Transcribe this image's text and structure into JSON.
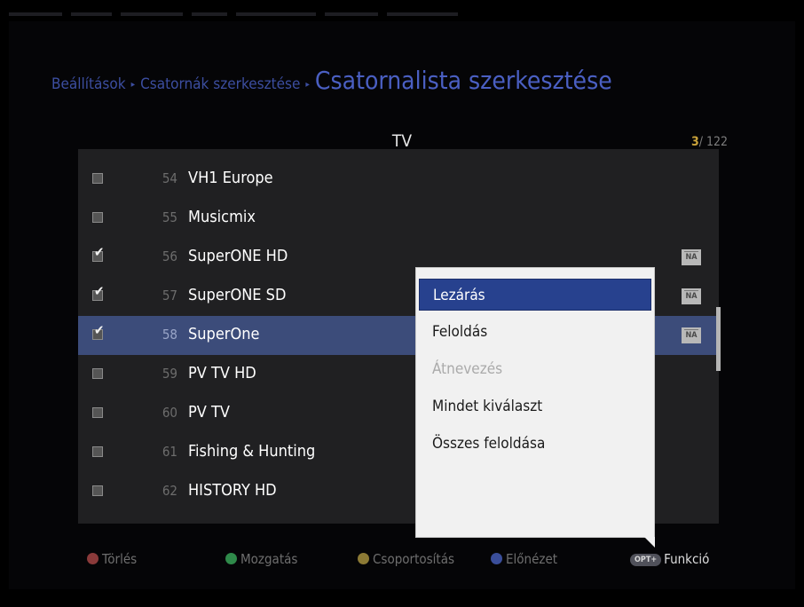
{
  "breadcrumb": {
    "items": [
      "Beállítások",
      "Csatornák szerkesztése"
    ],
    "current": "Csatornalista szerkesztése"
  },
  "list": {
    "title": "TV",
    "page_current": "3",
    "page_total": "/ 122",
    "badge_text": "NA",
    "channels": [
      {
        "num": "54",
        "name": "VH1 Europe",
        "checked": false,
        "locked": false,
        "selected": false
      },
      {
        "num": "55",
        "name": "Musicmix",
        "checked": false,
        "locked": false,
        "selected": false
      },
      {
        "num": "56",
        "name": "SuperONE HD",
        "checked": true,
        "locked": true,
        "selected": false
      },
      {
        "num": "57",
        "name": "SuperONE SD",
        "checked": true,
        "locked": true,
        "selected": false
      },
      {
        "num": "58",
        "name": "SuperOne",
        "checked": true,
        "locked": true,
        "selected": true
      },
      {
        "num": "59",
        "name": "PV TV HD",
        "checked": false,
        "locked": false,
        "selected": false
      },
      {
        "num": "60",
        "name": "PV TV",
        "checked": false,
        "locked": false,
        "selected": false
      },
      {
        "num": "61",
        "name": "Fishing & Hunting",
        "checked": false,
        "locked": false,
        "selected": false
      },
      {
        "num": "62",
        "name": "HISTORY HD",
        "checked": false,
        "locked": false,
        "selected": false
      }
    ]
  },
  "popup": {
    "items": [
      {
        "label": "Lezárás",
        "state": "active"
      },
      {
        "label": "Feloldás",
        "state": "normal"
      },
      {
        "label": "Átnevezés",
        "state": "disabled"
      },
      {
        "label": "Mindet kiválaszt",
        "state": "normal"
      },
      {
        "label": "Összes feloldása",
        "state": "normal"
      }
    ]
  },
  "footer": {
    "red": "Törlés",
    "green": "Mozgatás",
    "yellow": "Csoportosítás",
    "blue": "Előnézet",
    "opt_icon": "OPT+",
    "function": "Funkció"
  },
  "colors": {
    "red": "#8a3a3a",
    "green": "#2f8a4a",
    "yellow": "#8c7a35",
    "blue": "#3a4e9a",
    "accent": "#27418e"
  }
}
